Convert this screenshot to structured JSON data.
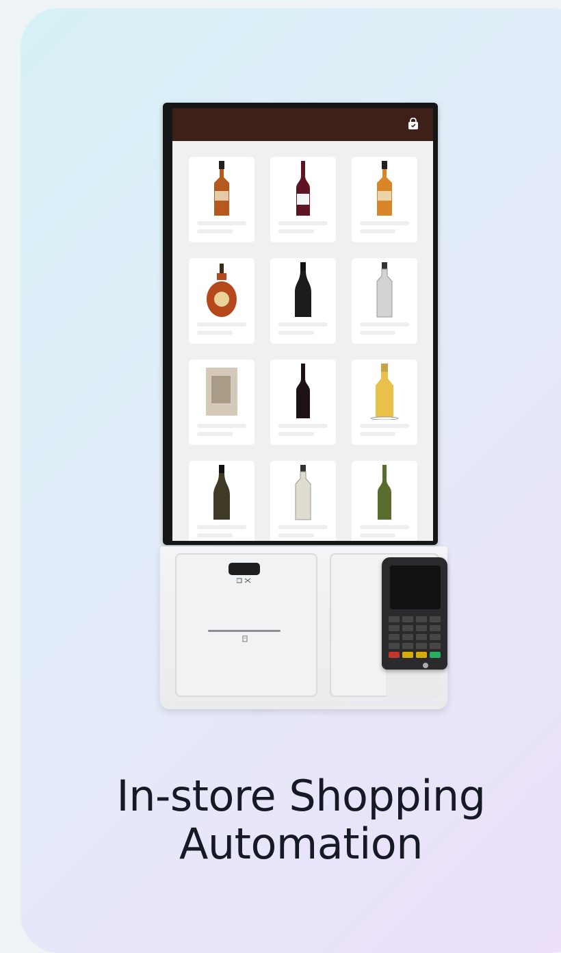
{
  "title": {
    "line1": "In-store Shopping",
    "line2": "Automation"
  },
  "kiosk": {
    "header_color": "#3d2118",
    "header_icon": "shopping-bag-icon",
    "products": [
      {
        "type": "whiskey",
        "color": "#b55a1c"
      },
      {
        "type": "red-wine",
        "color": "#5e1422"
      },
      {
        "type": "whiskey-light",
        "color": "#d9862a"
      },
      {
        "type": "cognac",
        "color": "#b5491c"
      },
      {
        "type": "champagne-dark",
        "color": "#1c1c1c"
      },
      {
        "type": "clear-bottle",
        "color": "#d0d2d4"
      },
      {
        "type": "blurred-item",
        "color": "#b9a58a"
      },
      {
        "type": "red-wine-dark",
        "color": "#1e1214"
      },
      {
        "type": "golden-liquor",
        "color": "#e8c04a"
      },
      {
        "type": "champagne-olive",
        "color": "#3e3a26"
      },
      {
        "type": "vodka",
        "color": "#e0dcd0"
      },
      {
        "type": "green-wine",
        "color": "#5b6d2e"
      }
    ]
  },
  "colors": {
    "title_text": "#161a24",
    "card_gradient_start": "#d6f1f6",
    "card_gradient_end": "#ecdffb"
  }
}
